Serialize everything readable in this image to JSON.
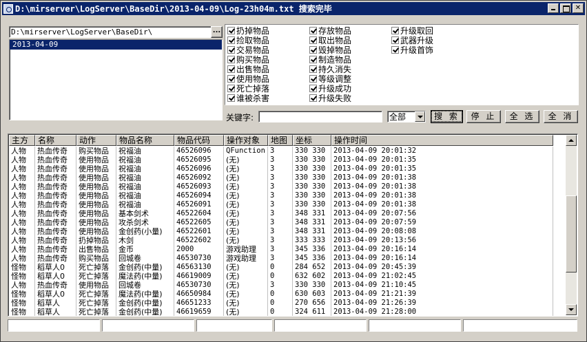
{
  "window": {
    "title": "D:\\mirserver\\LogServer\\BaseDir\\2013-04-09\\Log-23h04m.txt 搜索完毕"
  },
  "path_box": {
    "value": "D:\\mirserver\\LogServer\\BaseDir\\",
    "browse_label": "..."
  },
  "date_list": {
    "items": [
      "2013-04-09"
    ],
    "selected": "2013-04-09"
  },
  "filters": [
    {
      "label": "扔掉物品",
      "checked": true
    },
    {
      "label": "捡取物品",
      "checked": true
    },
    {
      "label": "交易物品",
      "checked": true
    },
    {
      "label": "购买物品",
      "checked": true
    },
    {
      "label": "出售物品",
      "checked": true
    },
    {
      "label": "使用物品",
      "checked": true
    },
    {
      "label": "死亡掉落",
      "checked": true
    },
    {
      "label": "谁被杀害",
      "checked": true
    },
    {
      "label": "存放物品",
      "checked": true
    },
    {
      "label": "取出物品",
      "checked": true
    },
    {
      "label": "毁掉物品",
      "checked": true
    },
    {
      "label": "制造物品",
      "checked": true
    },
    {
      "label": "持久消失",
      "checked": true
    },
    {
      "label": "等级调整",
      "checked": true
    },
    {
      "label": "升级成功",
      "checked": true
    },
    {
      "label": "升级失败",
      "checked": true
    },
    {
      "label": "升级取回",
      "checked": true
    },
    {
      "label": "武器升级",
      "checked": true
    },
    {
      "label": "升级首饰",
      "checked": true
    }
  ],
  "search": {
    "keyword_label": "关键字:",
    "keyword_value": "",
    "type_value": "全部",
    "search_label": "搜 索",
    "stop_label": "停 止",
    "select_all_label": "全 选",
    "cancel_label": "全 消"
  },
  "table": {
    "columns": [
      "主方",
      "名称",
      "动作",
      "物品名称",
      "物品代码",
      "操作对象",
      "地图",
      "坐标",
      "操作时间"
    ],
    "rows": [
      [
        "人物",
        "热血传奇",
        "购买物品",
        "祝福油",
        "46526096",
        "QFunction",
        "3",
        "330 330",
        "2013-04-09 20:01:32"
      ],
      [
        "人物",
        "热血传奇",
        "使用物品",
        "祝福油",
        "46526095",
        "(无)",
        "3",
        "330 330",
        "2013-04-09 20:01:35"
      ],
      [
        "人物",
        "热血传奇",
        "使用物品",
        "祝福油",
        "46526096",
        "(无)",
        "3",
        "330 330",
        "2013-04-09 20:01:35"
      ],
      [
        "人物",
        "热血传奇",
        "使用物品",
        "祝福油",
        "46526092",
        "(无)",
        "3",
        "330 330",
        "2013-04-09 20:01:38"
      ],
      [
        "人物",
        "热血传奇",
        "使用物品",
        "祝福油",
        "46526093",
        "(无)",
        "3",
        "330 330",
        "2013-04-09 20:01:38"
      ],
      [
        "人物",
        "热血传奇",
        "使用物品",
        "祝福油",
        "46526094",
        "(无)",
        "3",
        "330 330",
        "2013-04-09 20:01:38"
      ],
      [
        "人物",
        "热血传奇",
        "使用物品",
        "祝福油",
        "46526091",
        "(无)",
        "3",
        "330 330",
        "2013-04-09 20:01:38"
      ],
      [
        "人物",
        "热血传奇",
        "使用物品",
        "基本剑术",
        "46522604",
        "(无)",
        "3",
        "348 331",
        "2013-04-09 20:07:56"
      ],
      [
        "人物",
        "热血传奇",
        "使用物品",
        "攻杀剑术",
        "46522605",
        "(无)",
        "3",
        "348 331",
        "2013-04-09 20:07:59"
      ],
      [
        "人物",
        "热血传奇",
        "使用物品",
        "金创药(小量)",
        "46522601",
        "(无)",
        "3",
        "348 331",
        "2013-04-09 20:08:08"
      ],
      [
        "人物",
        "热血传奇",
        "扔掉物品",
        "木剑",
        "46522602",
        "(无)",
        "3",
        "333 333",
        "2013-04-09 20:13:56"
      ],
      [
        "人物",
        "热血传奇",
        "出售物品",
        "金币",
        "2000",
        "游戏助理",
        "3",
        "345 336",
        "2013-04-09 20:16:14"
      ],
      [
        "人物",
        "热血传奇",
        "购买物品",
        "回城卷",
        "46530730",
        "游戏助理",
        "3",
        "345 336",
        "2013-04-09 20:16:14"
      ],
      [
        "怪物",
        "稻草人0",
        "死亡掉落",
        "金创药(中量)",
        "46563130",
        "(无)",
        "0",
        "284 652",
        "2013-04-09 20:45:39"
      ],
      [
        "怪物",
        "稻草人0",
        "死亡掉落",
        "魔法药(中量)",
        "46619009",
        "(无)",
        "0",
        "632 602",
        "2013-04-09 21:02:45"
      ],
      [
        "人物",
        "热血传奇",
        "使用物品",
        "回城卷",
        "46530730",
        "(无)",
        "3",
        "330 330",
        "2013-04-09 21:10:45"
      ],
      [
        "怪物",
        "稻草人0",
        "死亡掉落",
        "魔法药(中量)",
        "46650984",
        "(无)",
        "0",
        "630 603",
        "2013-04-09 21:21:39"
      ],
      [
        "怪物",
        "稻草人",
        "死亡掉落",
        "金创药(中量)",
        "46651233",
        "(无)",
        "0",
        "270 656",
        "2013-04-09 21:26:39"
      ],
      [
        "怪物",
        "稻草人",
        "死亡掉落",
        "金创药(中量)",
        "46619659",
        "(无)",
        "0",
        "324 611",
        "2013-04-09 21:28:00"
      ]
    ]
  },
  "status": [
    "",
    "",
    "",
    "",
    "",
    ""
  ],
  "icons": {
    "app": "app-icon",
    "minimize": "minimize-icon",
    "maximize": "maximize-icon",
    "close": "close-icon"
  }
}
